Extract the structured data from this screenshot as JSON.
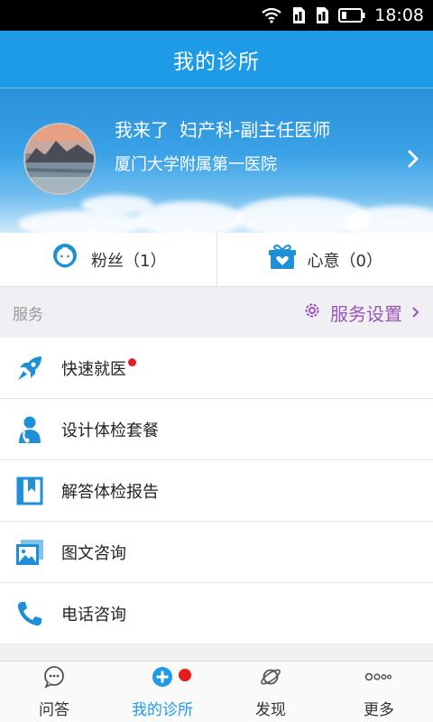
{
  "status_bar": {
    "time": "18:08"
  },
  "header": {
    "title": "我的诊所"
  },
  "profile": {
    "name": "我来了",
    "title": "妇产科-副主任医师",
    "hospital": "厦门大学附属第一医院"
  },
  "stats": {
    "fans_label": "粉丝（1）",
    "gifts_label": "心意（0）"
  },
  "services": {
    "section_label": "服务",
    "settings_label": "服务设置",
    "items": [
      {
        "label": "快速就医",
        "icon": "rocket-icon",
        "badge": true
      },
      {
        "label": "设计体检套餐",
        "icon": "doctor-person-icon",
        "badge": false
      },
      {
        "label": "解答体检报告",
        "icon": "bookmark-book-icon",
        "badge": false
      },
      {
        "label": "图文咨询",
        "icon": "picture-icon",
        "badge": false
      },
      {
        "label": "电话咨询",
        "icon": "phone-icon",
        "badge": false
      }
    ]
  },
  "tabbar": {
    "tabs": [
      {
        "label": "问答",
        "icon": "chat-bubble-icon",
        "active": false
      },
      {
        "label": "我的诊所",
        "icon": "clinic-cross-icon",
        "active": true,
        "badge": true
      },
      {
        "label": "发现",
        "icon": "planet-icon",
        "active": false
      },
      {
        "label": "更多",
        "icon": "more-dots-icon",
        "active": false
      }
    ]
  },
  "colors": {
    "primary": "#1e9be6",
    "accent_purple": "#9a55b8",
    "badge_red": "#e41d1d",
    "icon_blue": "#1f8fd6"
  }
}
